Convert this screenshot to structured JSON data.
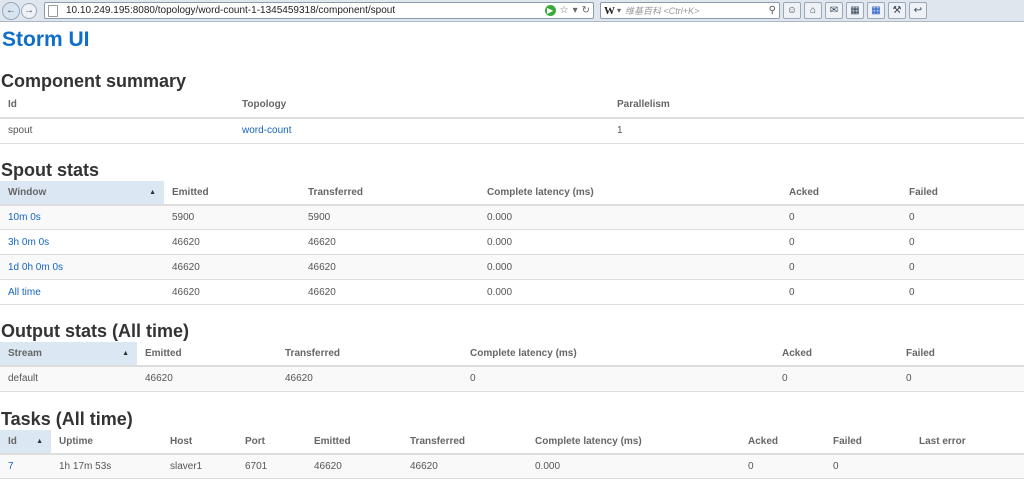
{
  "browser": {
    "url": "10.10.249.195:8080/topology/word-count-1-1345459318/component/spout",
    "search_placeholder": "维基百科 <Ctrl+K>"
  },
  "page": {
    "title": "Storm UI",
    "component_summary_heading": "Component summary",
    "spout_stats_heading": "Spout stats",
    "output_stats_heading": "Output stats (All time)",
    "tasks_heading": "Tasks (All time)"
  },
  "component_summary": {
    "headers": [
      "Id",
      "Topology",
      "Parallelism"
    ],
    "row": {
      "id": "spout",
      "topology": "word-count",
      "parallelism": "1"
    }
  },
  "spout_stats": {
    "headers": [
      "Window",
      "Emitted",
      "Transferred",
      "Complete latency (ms)",
      "Acked",
      "Failed"
    ],
    "rows": [
      {
        "window": "10m 0s",
        "emitted": "5900",
        "transferred": "5900",
        "latency": "0.000",
        "acked": "0",
        "failed": "0"
      },
      {
        "window": "3h 0m 0s",
        "emitted": "46620",
        "transferred": "46620",
        "latency": "0.000",
        "acked": "0",
        "failed": "0"
      },
      {
        "window": "1d 0h 0m 0s",
        "emitted": "46620",
        "transferred": "46620",
        "latency": "0.000",
        "acked": "0",
        "failed": "0"
      },
      {
        "window": "All time",
        "emitted": "46620",
        "transferred": "46620",
        "latency": "0.000",
        "acked": "0",
        "failed": "0"
      }
    ]
  },
  "output_stats": {
    "headers": [
      "Stream",
      "Emitted",
      "Transferred",
      "Complete latency (ms)",
      "Acked",
      "Failed"
    ],
    "rows": [
      {
        "stream": "default",
        "emitted": "46620",
        "transferred": "46620",
        "latency": "0",
        "acked": "0",
        "failed": "0"
      }
    ]
  },
  "tasks": {
    "headers": [
      "Id",
      "Uptime",
      "Host",
      "Port",
      "Emitted",
      "Transferred",
      "Complete latency (ms)",
      "Acked",
      "Failed",
      "Last error"
    ],
    "rows": [
      {
        "id": "7",
        "uptime": "1h 17m 53s",
        "host": "slaver1",
        "port": "6701",
        "emitted": "46620",
        "transferred": "46620",
        "latency": "0.000",
        "acked": "0",
        "failed": "0",
        "last_error": ""
      }
    ]
  }
}
